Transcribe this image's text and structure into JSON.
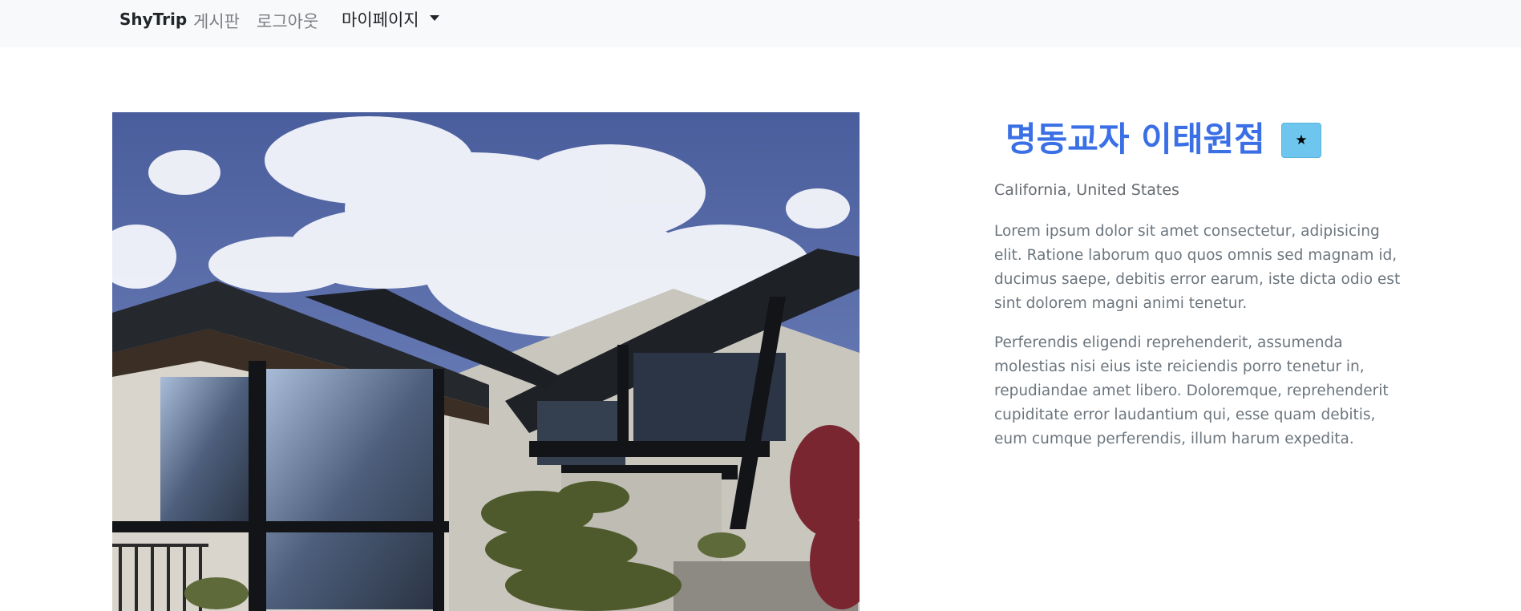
{
  "navbar": {
    "brand": "ShyTrip",
    "links": {
      "board": "게시판",
      "logout": "로그아웃",
      "mypage": "마이페이지"
    },
    "caret_icon": "caret-down-icon"
  },
  "main": {
    "photo_alt": "Modern house with large windows under a cloudy blue sky",
    "title": "명동교자 이태원점",
    "favorite_icon": "star-icon",
    "favorite_symbol": "★",
    "location": "California, United States",
    "paragraphs": [
      "Lorem ipsum dolor sit amet consectetur, adipisicing elit. Ratione laborum quo quos omnis sed magnam id, ducimus saepe, debitis error earum, iste dicta odio est sint dolorem magni animi tenetur.",
      "Perferendis eligendi reprehenderit, assumenda molestias nisi eius iste reiciendis porro tenetur in, repudiandae amet libero. Doloremque, reprehenderit cupiditate error laudantium qui, esse quam debitis, eum cumque perferendis, illum harum expedita."
    ]
  },
  "colors": {
    "navbar_bg": "#f8f9fa",
    "title": "#3b6fe6",
    "favorite_button": "#6ec6ee",
    "body_text": "#6c757d"
  }
}
